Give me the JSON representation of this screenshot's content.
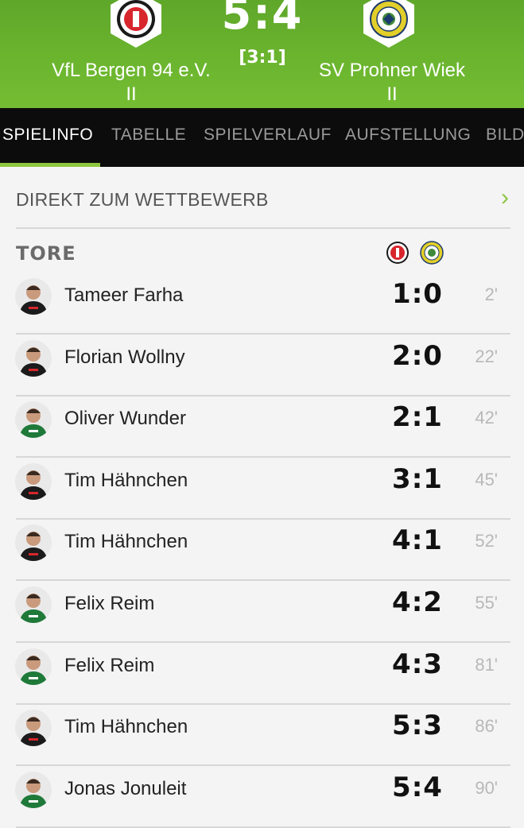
{
  "match": {
    "home_team": "VfL Bergen 94 e.V. II",
    "away_team": "SV Prohner Wiek II",
    "score": "5:4",
    "halftime": "[3:1]"
  },
  "tabs": [
    {
      "label": "SPIELINFO",
      "active": true
    },
    {
      "label": "TABELLE"
    },
    {
      "label": "SPIELVERLAUF"
    },
    {
      "label": "AUFSTELLUNG"
    },
    {
      "label": "BILD"
    }
  ],
  "competition_link": {
    "label": "DIREKT ZUM WETTBEWERB",
    "icon": "chevron-right-icon"
  },
  "goals_section": {
    "title": "TORE"
  },
  "goals": [
    {
      "player": "Tameer Farha",
      "score": "1:0",
      "minute": "2'",
      "team": "home"
    },
    {
      "player": "Florian Wollny",
      "score": "2:0",
      "minute": "22'",
      "team": "home"
    },
    {
      "player": "Oliver Wunder",
      "score": "2:1",
      "minute": "42'",
      "team": "away"
    },
    {
      "player": "Tim Hähnchen",
      "score": "3:1",
      "minute": "45'",
      "team": "home"
    },
    {
      "player": "Tim Hähnchen",
      "score": "4:1",
      "minute": "52'",
      "team": "home"
    },
    {
      "player": "Felix Reim",
      "score": "4:2",
      "minute": "55'",
      "team": "away"
    },
    {
      "player": "Felix Reim",
      "score": "4:3",
      "minute": "81'",
      "team": "away"
    },
    {
      "player": "Tim Hähnchen",
      "score": "5:3",
      "minute": "86'",
      "team": "home"
    },
    {
      "player": "Jonas Jonuleit",
      "score": "5:4",
      "minute": "90'",
      "team": "away"
    }
  ],
  "colors": {
    "accent": "#8dc63f",
    "header_green": "#6cb62f",
    "tab_bar": "#0c0c0c",
    "home_red": "#d8262d",
    "away_yellow": "#e2cf2a"
  }
}
